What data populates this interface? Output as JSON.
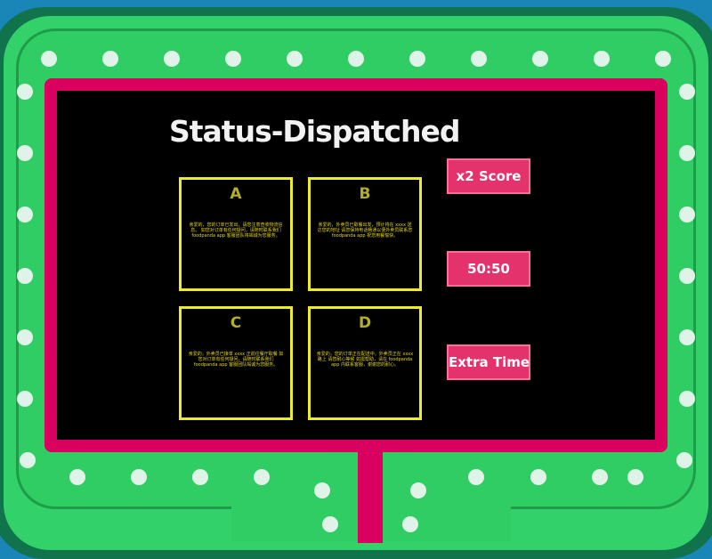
{
  "question": {
    "title": "Status-Dispatched"
  },
  "answers": [
    {
      "letter": "A",
      "text": "亲爱的，您的订单已发出，请您注意查收物流信息。 如您对订单有任何疑问，请随时联系我们 foodpanda app 客服团队将竭诚为您服务。"
    },
    {
      "letter": "B",
      "text": "亲爱的，外卖员已取餐出发，预计将在 xxxx 送达您的地址 请您保持电话畅通以便外卖员联系您 foodpanda app 祝您用餐愉快。"
    },
    {
      "letter": "C",
      "text": "亲爱的，外卖员已接单 xxxx 正前往餐厅取餐 如您对订单有任何疑问，请随时联系我们 foodpanda app 客服团队竭诚为您服务。"
    },
    {
      "letter": "D",
      "text": "亲爱的，您的订单正在配送中，外卖员正在 xxxx 路上 请您耐心等候 如需帮助，请在 foodpanda app 内联系客服，谢谢您的耐心。"
    }
  ],
  "powerups": {
    "double": "x2 Score",
    "fifty": "50:50",
    "time": "Extra Time"
  },
  "colors": {
    "background": "#1a86b8",
    "frame_green": "#2fcd63",
    "board_pink": "#d9005f",
    "board_black": "#000000",
    "answer_border": "#ecec2a",
    "button_pink": "#e4326d"
  }
}
